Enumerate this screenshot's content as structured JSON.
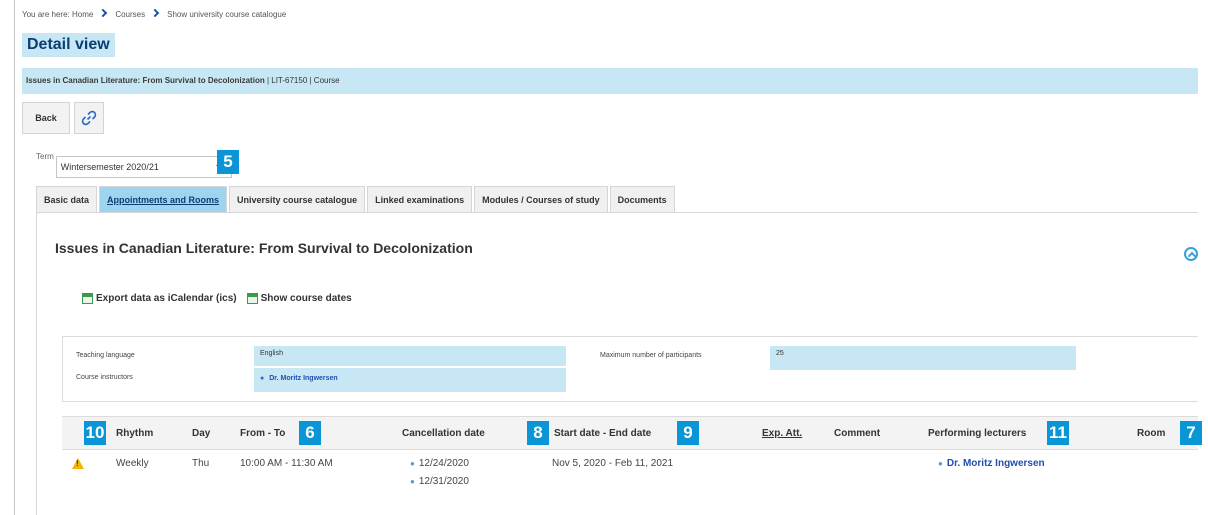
{
  "breadcrumb": {
    "prefix": "You are here:",
    "items": [
      "Home",
      "Courses",
      "Show university course catalogue"
    ]
  },
  "page": {
    "title": "Detail view",
    "course_name": "Issues in Canadian Literature: From Survival to Decolonization",
    "course_meta": "| LIT-67150 | Course"
  },
  "toolbar": {
    "back_label": "Back",
    "link_icon": "link-icon"
  },
  "term": {
    "label": "Term",
    "value": "Wintersemester 2020/21"
  },
  "tabs": [
    {
      "label": "Basic data"
    },
    {
      "label": "Appointments and Rooms",
      "active": true
    },
    {
      "label": "University course catalogue"
    },
    {
      "label": "Linked examinations"
    },
    {
      "label": "Modules / Courses of study"
    },
    {
      "label": "Documents"
    }
  ],
  "panel": {
    "title": "Issues in Canadian Literature: From Survival to Decolonization",
    "export_label": "Export data as iCalendar (ics)",
    "show_dates_label": "Show course dates"
  },
  "info": {
    "teaching_language_label": "Teaching language",
    "teaching_language": "English",
    "instructors_label": "Course instructors",
    "instructor": "Dr. Moritz Ingwersen",
    "max_participants_label": "Maximum number of participants",
    "max_participants": "25"
  },
  "table": {
    "headers": {
      "rhythm": "Rhythm",
      "day": "Day",
      "from_to": "From - To",
      "cancellation": "Cancellation date",
      "start_end": "Start date - End date",
      "exp_att": "Exp. Att.",
      "comment": "Comment",
      "lecturers": "Performing lecturers",
      "room": "Room"
    },
    "row": {
      "rhythm": "Weekly",
      "day": "Thu",
      "from_to": "10:00 AM - 11:30 AM",
      "cancellation_1": "12/24/2020",
      "cancellation_2": "12/31/2020",
      "start_end": "Nov 5, 2020 - Feb 11, 2021",
      "lecturer": "Dr. Moritz Ingwersen"
    }
  },
  "callouts": [
    "5",
    "6",
    "7",
    "8",
    "9",
    "10",
    "11"
  ],
  "colors": {
    "accent": "#0a96d6",
    "highlight": "#c7e7f5",
    "active_tab": "#9fd4ee",
    "title_text": "#0b3f73"
  }
}
